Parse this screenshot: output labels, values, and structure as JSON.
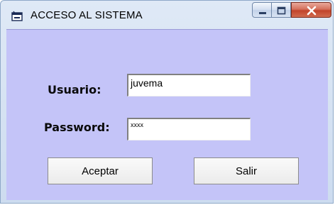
{
  "window": {
    "title": "ACCESO AL SISTEMA",
    "icon": "form-window-icon",
    "caption_buttons": [
      "minimize-icon",
      "maximize-icon",
      "close-icon"
    ]
  },
  "form": {
    "user_label": "Usuario:",
    "user_value": "juvema",
    "password_label": "Password:",
    "password_value": "xxxx",
    "accept_label": "Aceptar",
    "exit_label": "Salir"
  },
  "colors": {
    "client_background": "#c4c4f8",
    "close_button": "#c2442b"
  }
}
